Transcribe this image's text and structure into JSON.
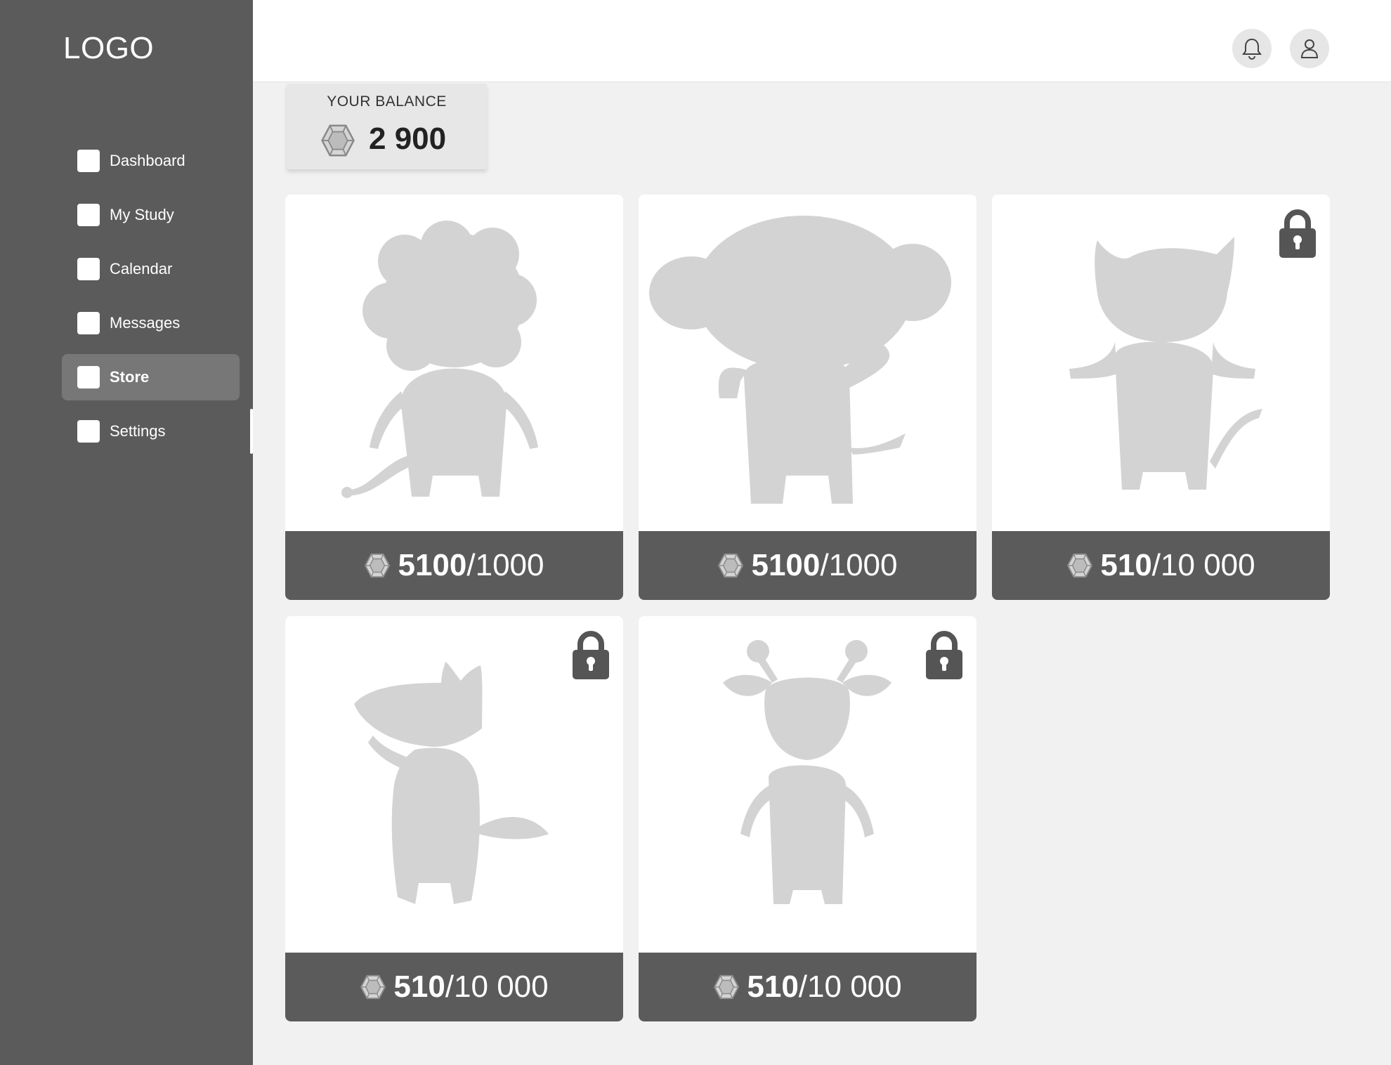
{
  "app": {
    "logo": "LOGO"
  },
  "sidebar": {
    "items": [
      {
        "label": "Dashboard",
        "active": false
      },
      {
        "label": "My Study",
        "active": false
      },
      {
        "label": "Calendar",
        "active": false
      },
      {
        "label": "Messages",
        "active": false
      },
      {
        "label": "Store",
        "active": true
      },
      {
        "label": "Settings",
        "active": false
      }
    ]
  },
  "header": {
    "icons": [
      "bell-icon",
      "user-icon"
    ]
  },
  "balance": {
    "label": "YOUR BALANCE",
    "value": "2 900",
    "icon": "gem-icon"
  },
  "store": {
    "items": [
      {
        "character": "lion",
        "owned": "5100",
        "sep": "/",
        "price": "1000",
        "locked": false
      },
      {
        "character": "elephant",
        "owned": "5100",
        "sep": "/",
        "price": "1000",
        "locked": false
      },
      {
        "character": "cat",
        "owned": "510",
        "sep": "/",
        "price": "10 000",
        "locked": true
      },
      {
        "character": "fox",
        "owned": "510",
        "sep": "/",
        "price": "10 000",
        "locked": true
      },
      {
        "character": "giraffe",
        "owned": "510",
        "sep": "/",
        "price": "10 000",
        "locked": true
      }
    ]
  },
  "colors": {
    "sidebar": "#5a5b5a",
    "sidebar_active": "#767776",
    "background": "#f1f1f1",
    "silhouette": "#d3d3d3",
    "price_bar": "#5a5b5a"
  }
}
